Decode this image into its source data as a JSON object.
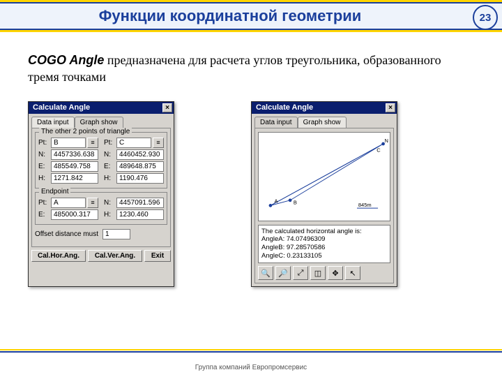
{
  "slide": {
    "title": "Функции координатной геометрии",
    "page_number": "23",
    "description_bold": "COGO Angle",
    "description_rest": " предназначена для расчета углов треугольника, образованного тремя точками",
    "footer": "Группа компаний Европромсервис"
  },
  "win1": {
    "title": "Calculate Angle",
    "tabs": [
      "Data input",
      "Graph show"
    ],
    "group1_legend": "The other 2 points of triangle",
    "pt_label": "Pt:",
    "n_label": "N:",
    "e_label": "E:",
    "h_label": "H:",
    "left": {
      "pt": "B",
      "n": "4457336.638",
      "e": "485549.758",
      "h": "1271.842"
    },
    "right": {
      "pt": "C",
      "n": "4460452.930",
      "e": "489648.875",
      "h": "1190.476"
    },
    "group2_legend": "Endpoint",
    "ep": {
      "pt": "A",
      "e": "485000.317",
      "n": "4457091.596",
      "h": "1230.460"
    },
    "offset_label": "Offset distance must",
    "offset_value": "1",
    "buttons": [
      "Cal.Hor.Ang.",
      "Cal.Ver.Ang.",
      "Exit"
    ]
  },
  "win2": {
    "title": "Calculate Angle",
    "tabs": [
      "Data input",
      "Graph show"
    ],
    "graph": {
      "points": {
        "A": "A",
        "B": "B",
        "C": "C",
        "N": "N"
      },
      "distance": "845m"
    },
    "result_header": "The calculated horizontal angle is:",
    "result_lines": [
      "AngleA: 74.07496309",
      "AngleB: 97.28570586",
      "AngleC: 0.23133105"
    ],
    "tool_icons": [
      "zoom-in-icon",
      "zoom-out-icon",
      "zoom-fit-icon",
      "zoom-select-icon",
      "pan-icon",
      "select-icon"
    ]
  }
}
